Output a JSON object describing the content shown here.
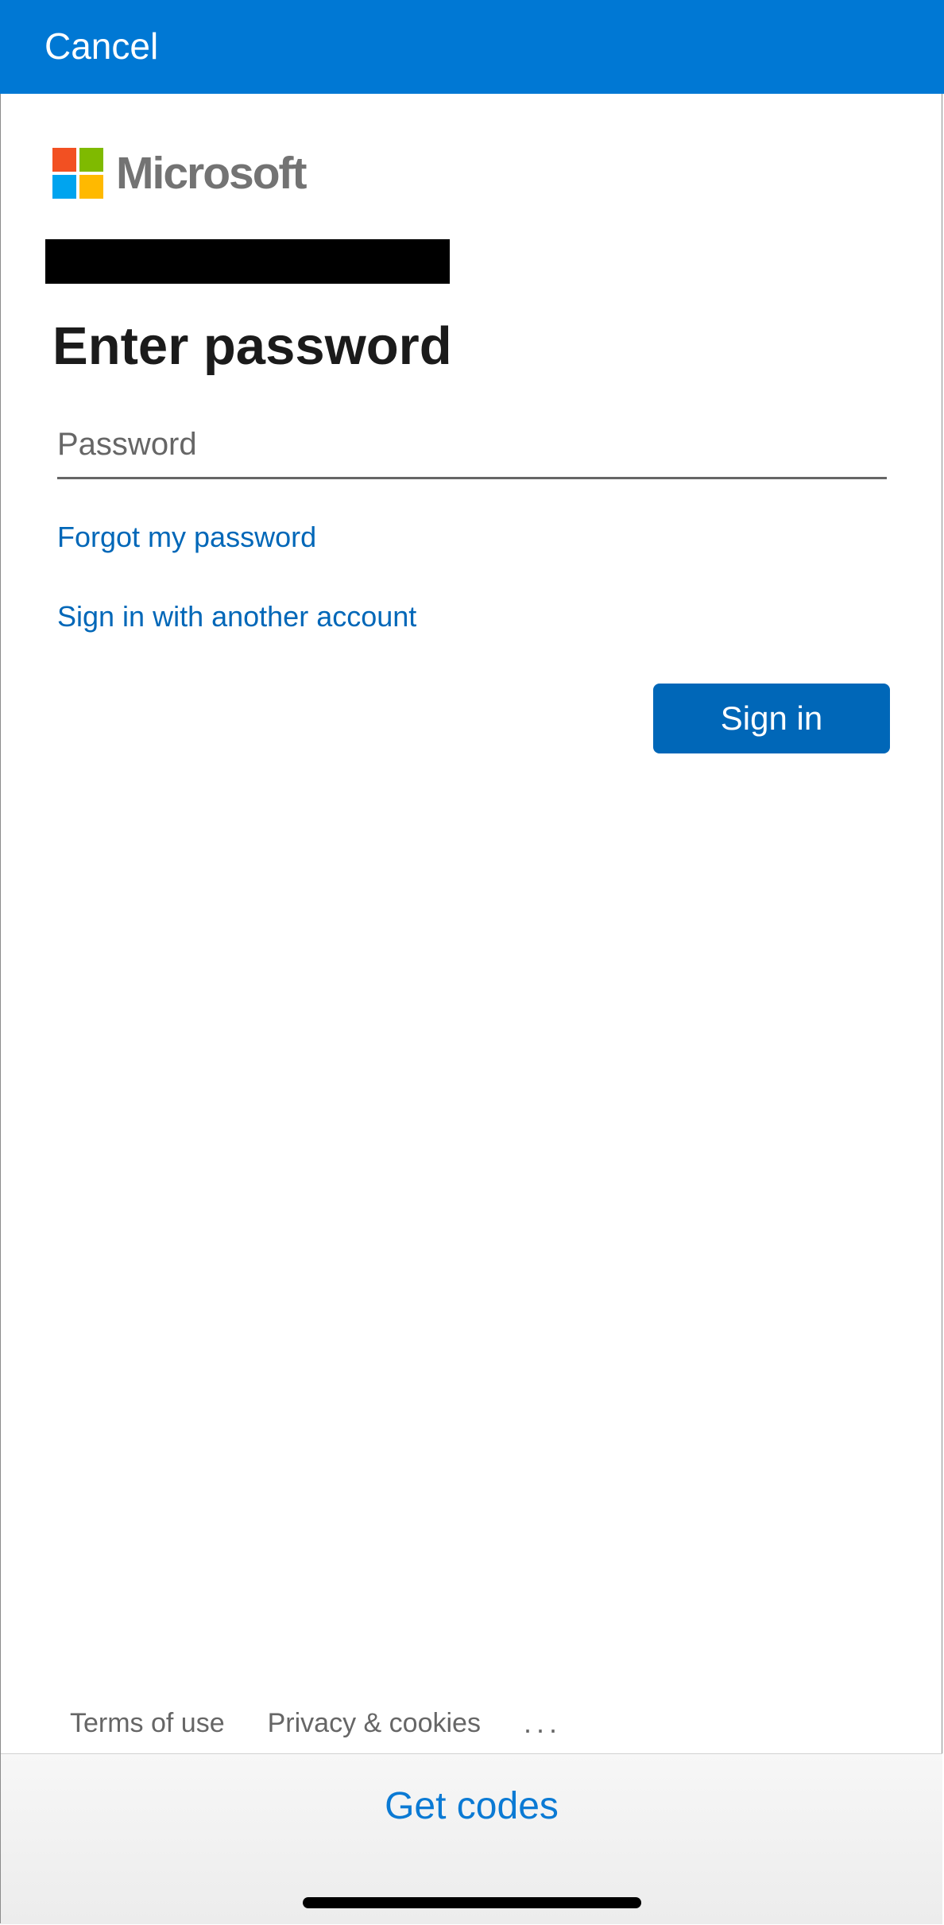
{
  "colors": {
    "topbar": "#0078d4",
    "link": "#0067b8",
    "button": "#0067b8",
    "get_codes": "#0b7ad4",
    "ms_red": "#f25022",
    "ms_green": "#7fba00",
    "ms_blue": "#00a4ef",
    "ms_yellow": "#ffb900"
  },
  "header": {
    "cancel_label": "Cancel"
  },
  "brand": {
    "name": "Microsoft",
    "icon": "microsoft-logo-icon"
  },
  "form": {
    "title": "Enter password",
    "password_placeholder": "Password",
    "password_value": "",
    "forgot_link": "Forgot my password",
    "another_account_link": "Sign in with another account",
    "signin_label": "Sign in"
  },
  "footer": {
    "terms": "Terms of use",
    "privacy": "Privacy & cookies",
    "more": "..."
  },
  "bottom_bar": {
    "get_codes_label": "Get codes"
  }
}
